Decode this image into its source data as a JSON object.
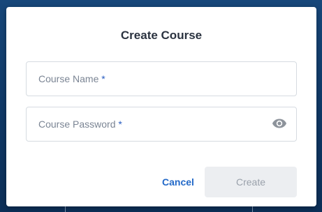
{
  "dialog": {
    "title": "Create Course",
    "fields": [
      {
        "label": "Course Name",
        "required_mark": "*",
        "value": ""
      },
      {
        "label": "Course Password",
        "required_mark": "*",
        "value": "",
        "icon": "eye-icon"
      }
    ],
    "cancel_label": "Cancel",
    "create_label": "Create"
  },
  "colors": {
    "backdrop": "#12427a",
    "accent_link": "#2369c8",
    "required_mark": "#2a5dc0",
    "disabled_button_bg": "#eceef1"
  }
}
